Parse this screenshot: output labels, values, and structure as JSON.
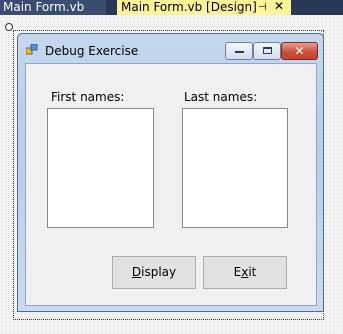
{
  "ide": {
    "tabs": [
      {
        "label": "Main Form.vb",
        "active": false
      },
      {
        "label": "Main Form.vb [Design]",
        "active": true
      }
    ],
    "pin_icon": "pin-icon",
    "close_icon": "close-icon",
    "colors": {
      "tab_strip": "#293955",
      "active_tab": "#fff29d"
    }
  },
  "form": {
    "title": "Debug Exercise",
    "app_icon": "form-app-icon",
    "labels": {
      "first_names": "First names:",
      "last_names": "Last names:"
    },
    "listboxes": {
      "first_names": [],
      "last_names": []
    },
    "buttons": {
      "display": {
        "accel": "D",
        "rest": "isplay"
      },
      "exit": {
        "pre": "E",
        "accel": "x",
        "rest": "it"
      }
    }
  }
}
